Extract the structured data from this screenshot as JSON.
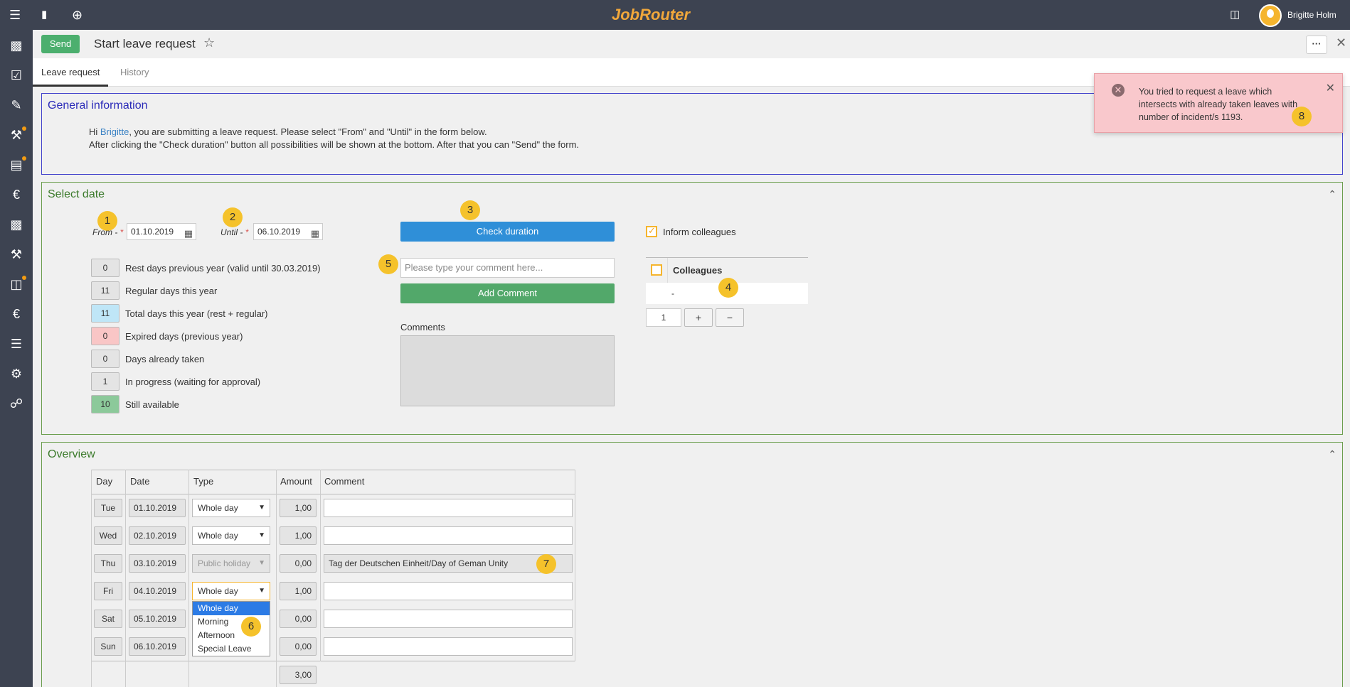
{
  "app": {
    "logo": "JobRouter",
    "user_name": "Brigitte Holm",
    "page_title": "Start leave request",
    "send_label": "Send",
    "more_label": "···"
  },
  "tabs": [
    {
      "label": "Leave request"
    },
    {
      "label": "History"
    }
  ],
  "general": {
    "title": "General information",
    "line1_pre": "Hi ",
    "line1_name": "Brigitte",
    "line1_post": ", you are submitting a leave request. Please select \"From\" and \"Until\" in the form below.",
    "line2": "After clicking the \"Check duration\" button all possibilities will be shown at the bottom. After that you can \"Send\" the form."
  },
  "select_date": {
    "title": "Select date",
    "from_label": "From -",
    "from_value": "01.10.2019",
    "until_label": "Until -",
    "until_value": "06.10.2019",
    "required_mark": "*",
    "stats": [
      {
        "value": "0",
        "label": "Rest days previous year (valid until 30.03.2019)",
        "color": "#e4e4e4"
      },
      {
        "value": "11",
        "label": "Regular days this year",
        "color": "#e4e4e4"
      },
      {
        "value": "11",
        "label": "Total days this year (rest + regular)",
        "color": "#bfe6f7"
      },
      {
        "value": "0",
        "label": "Expired days (previous year)",
        "color": "#f9c6c6"
      },
      {
        "value": "0",
        "label": "Days already taken",
        "color": "#e4e4e4"
      },
      {
        "value": "1",
        "label": "In progress (waiting for approval)",
        "color": "#e4e4e4"
      },
      {
        "value": "10",
        "label": "Still available",
        "color": "#8cc99a"
      }
    ],
    "check_duration_label": "Check duration",
    "comment_placeholder": "Please type your comment here...",
    "add_comment_label": "Add Comment",
    "comments_label": "Comments",
    "inform_colleagues_label": "Inform colleagues",
    "colleagues_header": "Colleagues",
    "colleague_value": "-",
    "count_value": "1",
    "plus_label": "+",
    "minus_label": "−"
  },
  "overview": {
    "title": "Overview",
    "headers": [
      "Day",
      "Date",
      "Type",
      "Amount",
      "Comment"
    ],
    "rows": [
      {
        "day": "Tue",
        "date": "01.10.2019",
        "type": "Whole day",
        "amount": "1,00",
        "comment": ""
      },
      {
        "day": "Wed",
        "date": "02.10.2019",
        "type": "Whole day",
        "amount": "1,00",
        "comment": ""
      },
      {
        "day": "Thu",
        "date": "03.10.2019",
        "type": "Public holiday",
        "amount": "0,00",
        "comment": "Tag der Deutschen Einheit/Day of Geman Unity"
      },
      {
        "day": "Fri",
        "date": "04.10.2019",
        "type": "Whole day",
        "amount": "1,00",
        "comment": ""
      },
      {
        "day": "Sat",
        "date": "05.10.2019",
        "type": "",
        "amount": "0,00",
        "comment": ""
      },
      {
        "day": "Sun",
        "date": "06.10.2019",
        "type": "",
        "amount": "0,00",
        "comment": ""
      }
    ],
    "total": "3,00",
    "dropdown_options": [
      "Whole day",
      "Morning",
      "Afternoon",
      "Special Leave"
    ]
  },
  "toast": {
    "message": "You tried to request a leave which intersects with already taken leaves with number of incident/s 1193."
  },
  "badges": [
    "1",
    "2",
    "3",
    "4",
    "5",
    "6",
    "7",
    "8"
  ],
  "icons": {
    "menu": "☰",
    "bookmark": "🔖",
    "add": "⊕",
    "clipboard": "📋",
    "star": "☆",
    "close": "✕",
    "calendar": "▦",
    "chevron_up": "⌃",
    "error": "✕",
    "arrow_down": "▼"
  }
}
